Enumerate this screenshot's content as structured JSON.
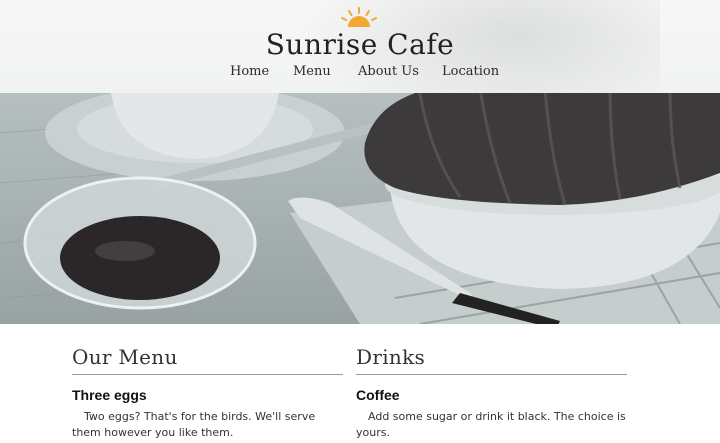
{
  "site": {
    "title": "Sunrise Cafe",
    "accent_color": "#f0a830",
    "logo_icon": "sun-icon"
  },
  "nav": {
    "items": [
      {
        "label": "Home"
      },
      {
        "label": "Menu"
      },
      {
        "label": "About Us"
      },
      {
        "label": "Location"
      }
    ]
  },
  "hero": {
    "image": "breakfast-photo-croissant-jam-coffee"
  },
  "sections": {
    "menu": {
      "heading": "Our Menu",
      "item_title": "Three eggs",
      "item_text": "Two eggs? That's for the birds. We'll serve them however you like them."
    },
    "drinks": {
      "heading": "Drinks",
      "item_title": "Coffee",
      "item_text": "Add some sugar or drink it black. The choice is yours."
    }
  }
}
